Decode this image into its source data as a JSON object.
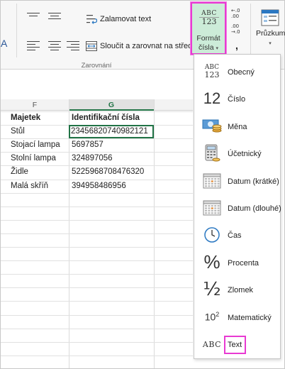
{
  "ribbon": {
    "cut_letter": "A",
    "wrap_text_label": "Zalamovat text",
    "merge_center_label": "Sloučit a zarovnat na střed",
    "alignment_group_label": "Zarovnání",
    "number_format": {
      "icon_line1": "ABC",
      "icon_line2": "123",
      "label_line1": "Formát",
      "label_line2": "čísla"
    },
    "increase_decimal": {
      "top": "←.0",
      "bottom": ".00"
    },
    "decrease_decimal": {
      "top": ".00",
      "bottom": "→.0"
    },
    "comma_label": ",",
    "survey_label": "Průzkum",
    "highlight_color": "#e83ad2",
    "active_bg": "#ccecd8"
  },
  "sheet": {
    "columns": [
      "F",
      "G"
    ],
    "active_column": "G",
    "rows": [
      {
        "f": "Majetek",
        "g": "Identifikační čísla",
        "header": true
      },
      {
        "f": "Stůl",
        "g": "23456820740982121"
      },
      {
        "f": "Stojací lampa",
        "g": "5697857"
      },
      {
        "f": "Stolní lampa",
        "g": "324897056"
      },
      {
        "f": "Židle",
        "g": "5225968708476320"
      },
      {
        "f": "Malá skříň",
        "g": "394958486956"
      }
    ],
    "selected_cell": "G2",
    "accent_color": "#217346"
  },
  "dropdown": {
    "items": [
      {
        "label": "Obecný",
        "icon": "general-icon",
        "glyph": "ABC\n123"
      },
      {
        "label": "Číslo",
        "icon": "number-icon",
        "glyph": "12"
      },
      {
        "label": "Měna",
        "icon": "currency-icon",
        "glyph": ""
      },
      {
        "label": "Účetnický",
        "icon": "accounting-icon",
        "glyph": ""
      },
      {
        "label": "Datum (krátké)",
        "icon": "short-date-icon",
        "glyph": ""
      },
      {
        "label": "Datum (dlouhé)",
        "icon": "long-date-icon",
        "glyph": ""
      },
      {
        "label": "Čas",
        "icon": "clock-icon",
        "glyph": ""
      },
      {
        "label": "Procenta",
        "icon": "percent-icon",
        "glyph": "%"
      },
      {
        "label": "Zlomek",
        "icon": "fraction-icon",
        "glyph": "½"
      },
      {
        "label": "Matematický",
        "icon": "scientific-icon",
        "glyph": "10²"
      },
      {
        "label": "Text",
        "icon": "text-icon",
        "glyph": "ABC"
      }
    ],
    "highlighted_item": "Text"
  }
}
